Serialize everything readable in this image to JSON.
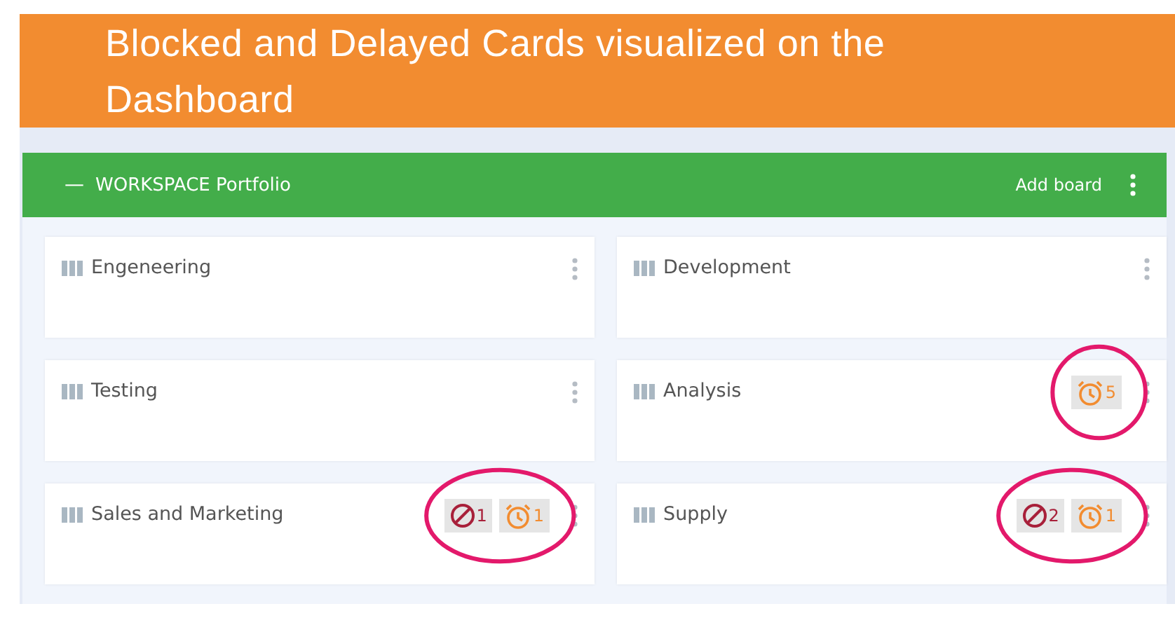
{
  "banner": {
    "title": "Blocked and Delayed Cards visualized on the Dashboard"
  },
  "workspace": {
    "collapse_glyph": "—",
    "title": "WORKSPACE Portfolio",
    "add_button": "Add board"
  },
  "boards": [
    {
      "name": "Engeneering",
      "highlighted": false
    },
    {
      "name": "Development",
      "highlighted": false
    },
    {
      "name": "Testing",
      "highlighted": false
    },
    {
      "name": "Analysis",
      "badges": [
        {
          "kind": "delayed",
          "count": "5"
        }
      ],
      "highlighted": true
    },
    {
      "name": "Sales and Marketing",
      "badges": [
        {
          "kind": "blocked",
          "count": "1"
        },
        {
          "kind": "delayed",
          "count": "1"
        }
      ],
      "highlighted": true
    },
    {
      "name": "Supply",
      "badges": [
        {
          "kind": "blocked",
          "count": "2"
        },
        {
          "kind": "delayed",
          "count": "1"
        }
      ],
      "highlighted": true
    }
  ]
}
